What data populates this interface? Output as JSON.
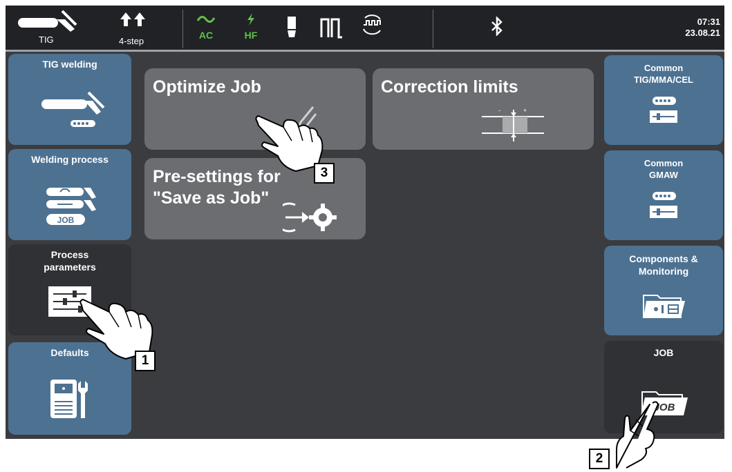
{
  "topbar": {
    "process": "TIG",
    "mode": "4-step",
    "ac": "AC",
    "hf": "HF",
    "time": "07:31",
    "date": "23.08.21",
    "icons": [
      "tig-torch-icon",
      "4-step-icon",
      "ac-wave-icon",
      "hf-icon",
      "electrode-icon",
      "pulse-icon",
      "rotate-wave-icon",
      "bluetooth-icon"
    ]
  },
  "left_menu": [
    {
      "label": "TIG welding",
      "icon": "tig-torch-icon"
    },
    {
      "label": "Welding process",
      "icon": "welding-process-job-icon"
    },
    {
      "label": "Process parameters",
      "icon": "sliders-icon"
    },
    {
      "label": "Defaults",
      "icon": "device-wrench-icon"
    }
  ],
  "tiles": [
    {
      "label": "Optimize Job",
      "icon": "paperclip-icon"
    },
    {
      "label": "Correction limits",
      "icon": "limits-icon"
    },
    {
      "label": "Pre-settings for \"Save as Job\"",
      "icon": "save-settings-gear-icon"
    }
  ],
  "right_menu": [
    {
      "label": "Common TIG/MMA/CEL",
      "icon": "parameters-slider-icon"
    },
    {
      "label": "Common GMAW",
      "icon": "parameters-slider-icon"
    },
    {
      "label": "Components & Monitoring",
      "icon": "components-folder-icon"
    },
    {
      "label": "JOB",
      "icon": "job-folder-icon",
      "icon_text": "JOB"
    }
  ],
  "callouts": [
    "1",
    "2",
    "3"
  ],
  "colors": {
    "blue_button": "#4d7191",
    "dark_button": "#2f3135",
    "tile": "#6b6d70",
    "background": "#3a3c40",
    "topbar": "#202226",
    "accent_green": "#63c04b"
  }
}
